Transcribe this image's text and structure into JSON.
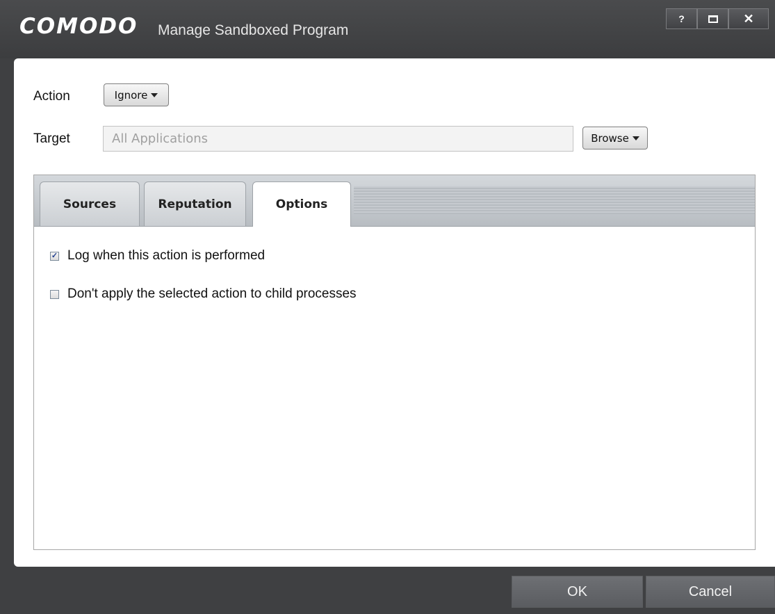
{
  "window": {
    "brand": "COMODO",
    "title": "Manage Sandboxed Program",
    "controls": {
      "help": "?",
      "close": "✕"
    }
  },
  "action": {
    "label": "Action",
    "value": "Ignore"
  },
  "target": {
    "label": "Target",
    "value": "All Applications",
    "browse_label": "Browse"
  },
  "tabs": [
    {
      "label": "Sources",
      "active": false
    },
    {
      "label": "Reputation",
      "active": false
    },
    {
      "label": "Options",
      "active": true
    }
  ],
  "options": [
    {
      "label": "Log when this action is performed",
      "checked": true
    },
    {
      "label": "Don't apply the selected action to child processes",
      "checked": false
    }
  ],
  "footer": {
    "ok_label": "OK",
    "cancel_label": "Cancel"
  },
  "colors": {
    "window_bg": "#3f4042",
    "panel_bg": "#ffffff",
    "tab_strip": "#c2c6cb"
  },
  "icons": {
    "checkmark": "checkmark-icon",
    "dropdown": "caret-down-icon"
  }
}
